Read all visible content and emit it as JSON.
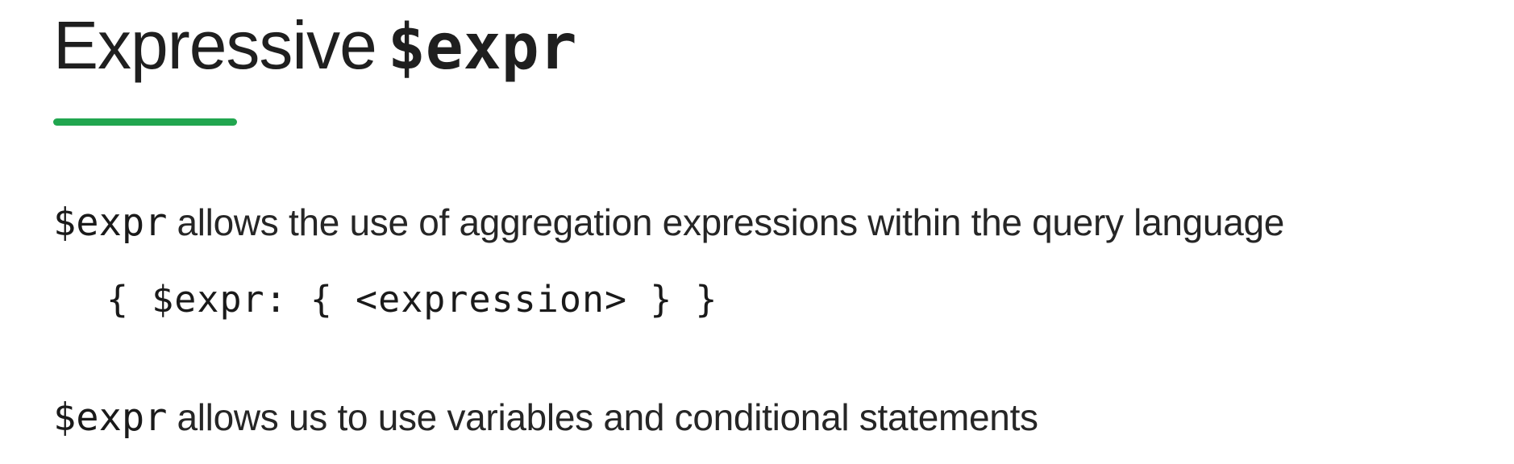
{
  "slide": {
    "title_text": "Expressive",
    "title_code": "$expr",
    "accent_color": "#21a64f",
    "points": [
      {
        "code": "$expr",
        "text": "allows the use of aggregation expressions within the query language"
      },
      {
        "code": "$expr",
        "text": "allows us to use variables and conditional statements"
      }
    ],
    "syntax": "{ $expr: { <expression> } }"
  }
}
